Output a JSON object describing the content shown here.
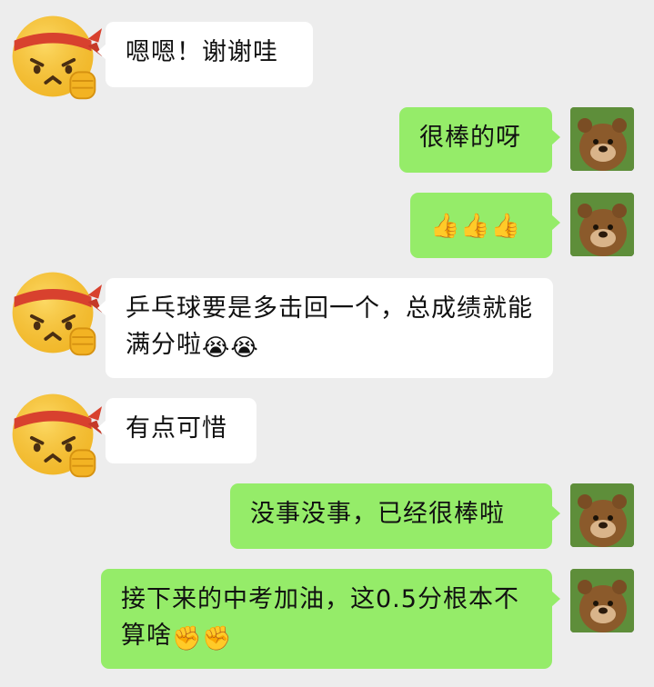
{
  "messages": [
    {
      "side": "left",
      "text": "嗯嗯！谢谢哇",
      "emoji": ""
    },
    {
      "side": "right",
      "text": "很棒的呀",
      "emoji": ""
    },
    {
      "side": "right",
      "text": "",
      "emoji": "👍👍👍"
    },
    {
      "side": "left",
      "text": "乒乓球要是多击回一个，总成绩就能满分啦",
      "emoji": "😭😭"
    },
    {
      "side": "left",
      "text": "有点可惜",
      "emoji": ""
    },
    {
      "side": "right",
      "text": "没事没事，已经很棒啦",
      "emoji": ""
    },
    {
      "side": "right",
      "text": "接下来的中考加油，这0.5分根本不算啥",
      "emoji": "✊✊"
    }
  ],
  "colors": {
    "background": "#ededed",
    "incoming_bubble": "#ffffff",
    "outgoing_bubble": "#95ec69"
  },
  "icons": {
    "left_avatar": "headband-emoji-avatar-icon",
    "right_avatar": "bear-avatar-icon"
  }
}
